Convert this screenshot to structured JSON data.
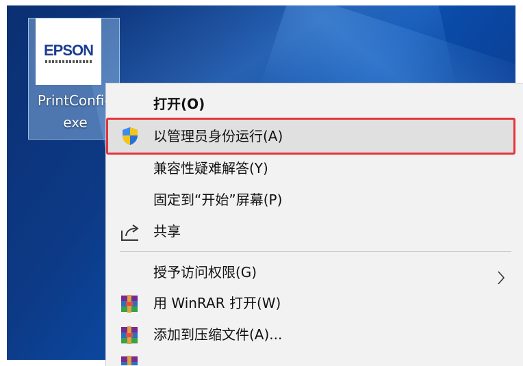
{
  "desktop_icon": {
    "logo_text": "EPSON",
    "label_line1": "PrintConfig",
    "label_line2": "exe"
  },
  "context_menu": {
    "items": [
      {
        "label": "打开(O)",
        "icon": ""
      },
      {
        "label": "以管理员身份运行(A)",
        "icon": "uac-shield-icon"
      },
      {
        "label": "兼容性疑难解答(Y)",
        "icon": ""
      },
      {
        "label": "固定到“开始”屏幕(P)",
        "icon": ""
      },
      {
        "label": "共享",
        "icon": "share-icon"
      },
      {
        "label": "授予访问权限(G)",
        "icon": "chevron-right-icon"
      },
      {
        "label": "用 WinRAR 打开(W)",
        "icon": "winrar-icon"
      },
      {
        "label": "添加到压缩文件(A)...",
        "icon": "winrar-icon"
      }
    ]
  },
  "colors": {
    "highlight_border": "#e2343a",
    "menu_background": "#f2f2f2",
    "desktop_blue": "#0d3a86"
  }
}
